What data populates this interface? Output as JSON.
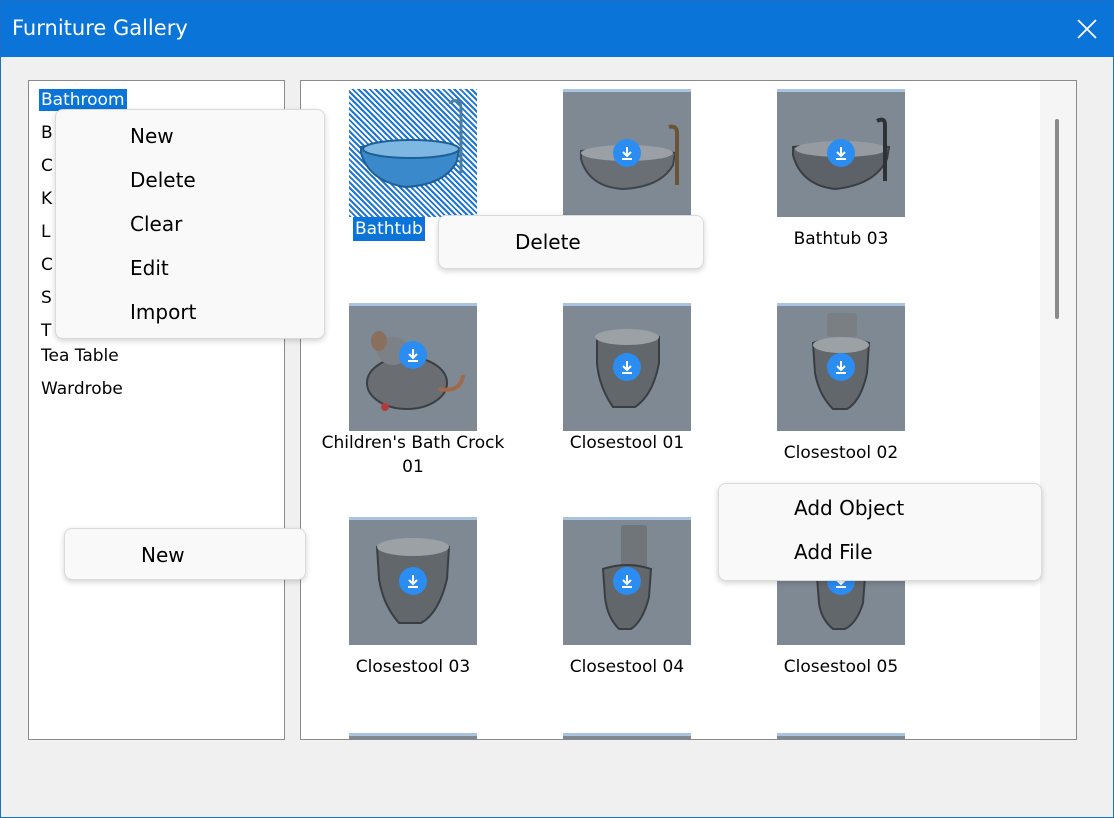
{
  "window": {
    "title": "Furniture Gallery",
    "close_glyph": "✕"
  },
  "categories": {
    "items": [
      {
        "label": "Bathroom",
        "selected": true
      },
      {
        "label": "B"
      },
      {
        "label": "C"
      },
      {
        "label": "K"
      },
      {
        "label": "L"
      },
      {
        "label": "C"
      },
      {
        "label": "S"
      },
      {
        "label": "T"
      },
      {
        "label": "Tea Table"
      },
      {
        "label": "Wardrobe"
      }
    ]
  },
  "gallery": {
    "items": [
      {
        "label": "Bathtub",
        "selected": true,
        "icon": "bathtub-icon"
      },
      {
        "label": "",
        "icon": "bathtub-icon"
      },
      {
        "label": "Bathtub 03",
        "icon": "bathtub-icon"
      },
      {
        "label": "Children's Bath Crock",
        "label2": "01",
        "icon": "bath-crock-icon"
      },
      {
        "label": "Closestool 01",
        "icon": "toilet-icon"
      },
      {
        "label": "Closestool 02",
        "icon": "toilet-icon"
      },
      {
        "label": "Closestool 03",
        "icon": "toilet-icon"
      },
      {
        "label": "Closestool 04",
        "icon": "toilet-icon"
      },
      {
        "label": "Closestool 05",
        "icon": "toilet-icon"
      }
    ]
  },
  "context_menus": {
    "category_menu": [
      "New",
      "Delete",
      "Clear",
      "Edit",
      "Import"
    ],
    "item_menu": [
      "Delete"
    ],
    "blank_category_menu": [
      "New"
    ],
    "blank_gallery_menu": [
      "Add Object",
      "Add File"
    ]
  },
  "colors": {
    "accent": "#0a74d9",
    "thumb_bg": "#7f8994",
    "badge": "#2b8cf2"
  }
}
